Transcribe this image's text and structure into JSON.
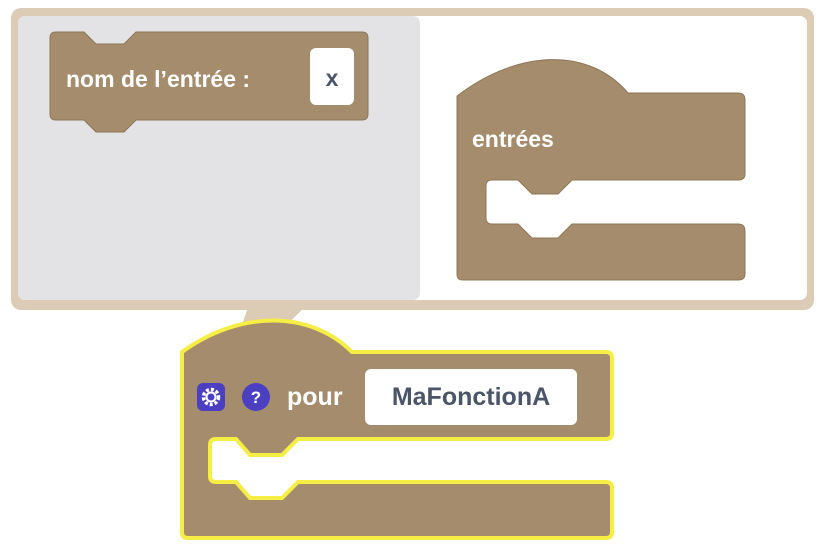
{
  "mutator": {
    "flyout_block": {
      "label": "nom de l’entrée :",
      "value": "x"
    },
    "container_block": {
      "label": "entrées"
    }
  },
  "main_block": {
    "keyword": "pour",
    "function_name": "MaFonctionA",
    "gear_icon": "gear-icon",
    "help_icon": "question-icon"
  },
  "colors": {
    "block": "#a48c6c",
    "block_stroke": "#8d7657",
    "highlight": "#f6ed45",
    "bubble_border": "#dccbb5",
    "flyout_bg": "#e3e3e5",
    "icon_blue": "#4b3fc2",
    "field_text": "#4a5568"
  }
}
